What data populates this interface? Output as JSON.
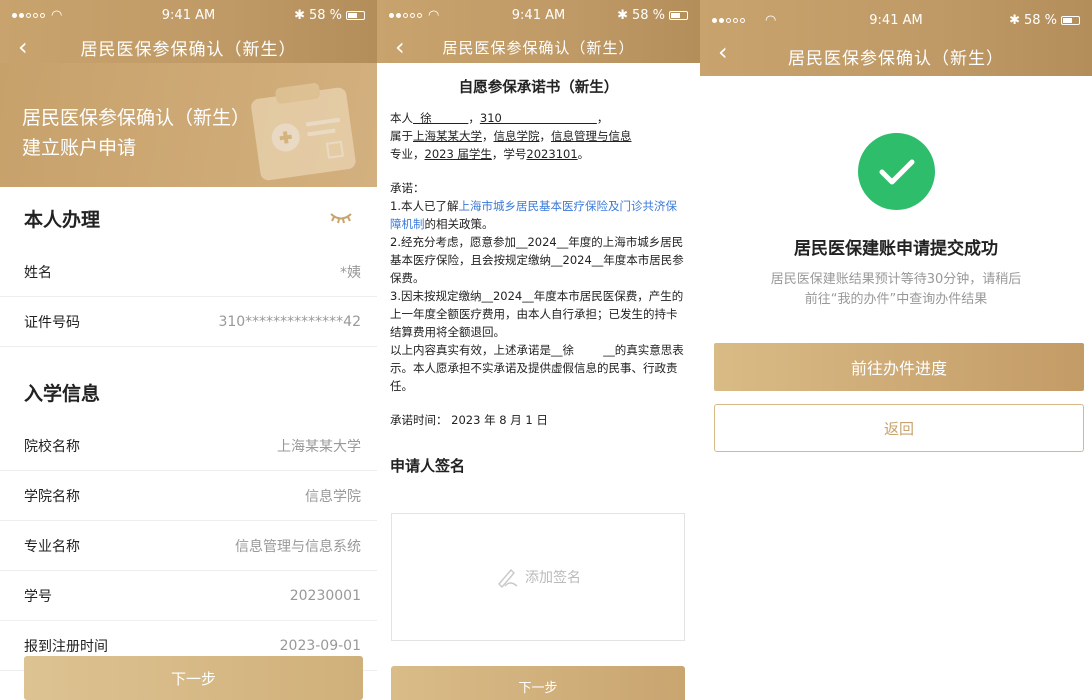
{
  "status": {
    "time": "9:41 AM",
    "battery": "58 %"
  },
  "screen1": {
    "nav_title": "居民医保参保确认（新生）",
    "hero_line1": "居民医保参保确认（新生）",
    "hero_line2": "建立账户申请",
    "section_self": "本人办理",
    "section_school": "入学信息",
    "rows_self": [
      {
        "label": "姓名",
        "value": "*姨"
      },
      {
        "label": "证件号码",
        "value": "310**************42"
      }
    ],
    "rows_school": [
      {
        "label": "院校名称",
        "value": "上海某某大学"
      },
      {
        "label": "学院名称",
        "value": "信息学院"
      },
      {
        "label": "专业名称",
        "value": "信息管理与信息系统"
      },
      {
        "label": "学号",
        "value": "20230001"
      },
      {
        "label": "报到注册时间",
        "value": "2023-09-01"
      }
    ],
    "next_button": "下一步"
  },
  "screen2": {
    "nav_title": "居民医保参保确认（新生）",
    "doc_title": "自愿参保承诺书（新生）",
    "p1_a": "本人",
    "p1_name": "  徐          ",
    "p1_b": "，",
    "p1_id": "310                          ",
    "p1_c": "，",
    "p2_a": "属于",
    "p2_school": "上海某某大学",
    "p2_b": "，",
    "p2_college": "信息学院",
    "p2_c": "，",
    "p2_major": "信息管理与信息",
    "p3_a": "专业，",
    "p3_year": "2023 届学生",
    "p3_b": "，学号",
    "p3_sid": "2023101",
    "p3_c": "。",
    "promise_h": "承诺：",
    "c1_a": "1.本人已了解",
    "c1_link": "上海市城乡居民基本医疗保险及门诊共济保障机制",
    "c1_b": "的相关政策。",
    "c2": "2.经充分考虑，愿意参加__2024__年度的上海市城乡居民基本医疗保险，且会按规定缴纳__2024__年度本市居民参保费。",
    "c3": "3.因未按规定缴纳__2024__年度本市居民医保费，产生的上一年度全额医疗费用，由本人自行承担；已发生的持卡结算费用将全额退回。",
    "c4": "以上内容真实有效，上述承诺是__徐        __的真实意思表示。本人愿承担不实承诺及提供虚假信息的民事、行政责任。",
    "time_line": "承诺时间：  2023 年 8 月 1 日",
    "sign_header": "申请人签名",
    "sign_placeholder": "添加签名",
    "next_button": "下一步"
  },
  "screen3": {
    "nav_title": "居民医保参保确认（新生）",
    "success_title": "居民医保建账申请提交成功",
    "success_desc_1": "居民医保建账结果预计等待30分钟，请稍后",
    "success_desc_2": "前往“我的办件”中查询办件结果",
    "progress_button": "前往办件进度",
    "return_button": "返回"
  },
  "colors": {
    "gold": "#c9a36d",
    "success": "#2ebd6a",
    "link": "#3b7ad9"
  }
}
